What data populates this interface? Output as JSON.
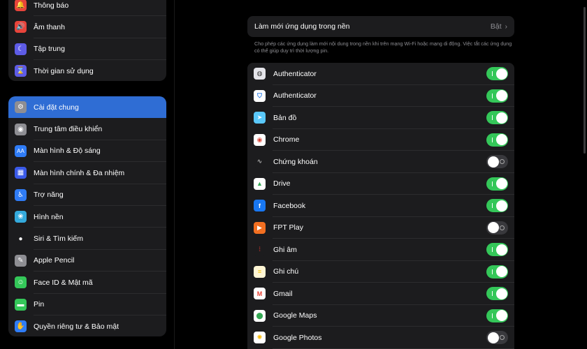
{
  "sidebar": {
    "group1": [
      {
        "label": "Thông báo",
        "icon": "bell-icon",
        "color": "#e8443b",
        "glyph": "🔔"
      },
      {
        "label": "Âm thanh",
        "icon": "speaker-icon",
        "color": "#e8443b",
        "glyph": "🔊"
      },
      {
        "label": "Tập trung",
        "icon": "moon-icon",
        "color": "#5e5ce6",
        "glyph": "☾"
      },
      {
        "label": "Thời gian sử dụng",
        "icon": "hourglass-icon",
        "color": "#5e5ce6",
        "glyph": "⌛"
      }
    ],
    "group2": [
      {
        "label": "Cài đặt chung",
        "icon": "gear-icon",
        "color": "#8e8e93",
        "glyph": "⚙",
        "active": true
      },
      {
        "label": "Trung tâm điều khiển",
        "icon": "control-center-icon",
        "color": "#8e8e93",
        "glyph": "◉"
      },
      {
        "label": "Màn hình & Độ sáng",
        "icon": "display-brightness-icon",
        "color": "#2f7cf6",
        "glyph": "AA"
      },
      {
        "label": "Màn hình chính & Đa nhiệm",
        "icon": "home-screen-icon",
        "color": "#3a5ae8",
        "glyph": "▦"
      },
      {
        "label": "Trợ năng",
        "icon": "accessibility-icon",
        "color": "#2f7cf6",
        "glyph": "♿"
      },
      {
        "label": "Hình nền",
        "icon": "wallpaper-icon",
        "color": "#34aadc",
        "glyph": "❀"
      },
      {
        "label": "Siri & Tìm kiếm",
        "icon": "siri-icon",
        "color": "#1c1c1e",
        "glyph": "●"
      },
      {
        "label": "Apple Pencil",
        "icon": "pencil-icon",
        "color": "#8e8e93",
        "glyph": "✎"
      },
      {
        "label": "Face ID & Mật mã",
        "icon": "face-id-icon",
        "color": "#34c759",
        "glyph": "☺"
      },
      {
        "label": "Pin",
        "icon": "battery-icon",
        "color": "#34c759",
        "glyph": "▬"
      },
      {
        "label": "Quyền riêng tư & Bảo mật",
        "icon": "hand-icon",
        "color": "#2f7cf6",
        "glyph": "✋"
      }
    ]
  },
  "main": {
    "refresh_label": "Làm mới ứng dụng trong nền",
    "refresh_value": "Bật",
    "description": "Cho phép các ứng dụng làm mới nội dung trong nền khi trên mạng Wi-Fi hoặc mạng di động. Việc tắt các ứng dụng có thể giúp duy trì thời lượng pin.",
    "apps": [
      {
        "label": "Authenticator",
        "icon": "authenticator-icon",
        "color": "#e5e5ea",
        "glyph": "◍",
        "glyph_color": "#333",
        "on": true
      },
      {
        "label": "Authenticator",
        "icon": "microsoft-authenticator-icon",
        "color": "#ffffff",
        "glyph": "⛉",
        "glyph_color": "#1a73e8",
        "on": true
      },
      {
        "label": "Bản đồ",
        "icon": "maps-icon",
        "color": "#5ac8fa",
        "glyph": "➤",
        "glyph_color": "#fff",
        "on": true
      },
      {
        "label": "Chrome",
        "icon": "chrome-icon",
        "color": "#ffffff",
        "glyph": "◉",
        "glyph_color": "#db4437",
        "on": true
      },
      {
        "label": "Chứng khoán",
        "icon": "stocks-icon",
        "color": "#1c1c1e",
        "glyph": "∿",
        "glyph_color": "#aaa",
        "on": false
      },
      {
        "label": "Drive",
        "icon": "drive-icon",
        "color": "#ffffff",
        "glyph": "▲",
        "glyph_color": "#34a853",
        "on": true
      },
      {
        "label": "Facebook",
        "icon": "facebook-icon",
        "color": "#1877f2",
        "glyph": "f",
        "glyph_color": "#fff",
        "on": true
      },
      {
        "label": "FPT Play",
        "icon": "fpt-play-icon",
        "color": "#f26f21",
        "glyph": "▶",
        "glyph_color": "#fff",
        "on": false
      },
      {
        "label": "Ghi âm",
        "icon": "voice-memos-icon",
        "color": "#1c1c1e",
        "glyph": "⫶",
        "glyph_color": "#ff3b30",
        "on": true
      },
      {
        "label": "Ghi chú",
        "icon": "notes-icon",
        "color": "#fff6d5",
        "glyph": "≡",
        "glyph_color": "#f5c400",
        "on": true
      },
      {
        "label": "Gmail",
        "icon": "gmail-icon",
        "color": "#ffffff",
        "glyph": "M",
        "glyph_color": "#ea4335",
        "on": true
      },
      {
        "label": "Google Maps",
        "icon": "google-maps-icon",
        "color": "#ffffff",
        "glyph": "⬤",
        "glyph_color": "#34a853",
        "on": true
      },
      {
        "label": "Google Photos",
        "icon": "google-photos-icon",
        "color": "#ffffff",
        "glyph": "✺",
        "glyph_color": "#fbbc05",
        "on": false
      }
    ]
  }
}
